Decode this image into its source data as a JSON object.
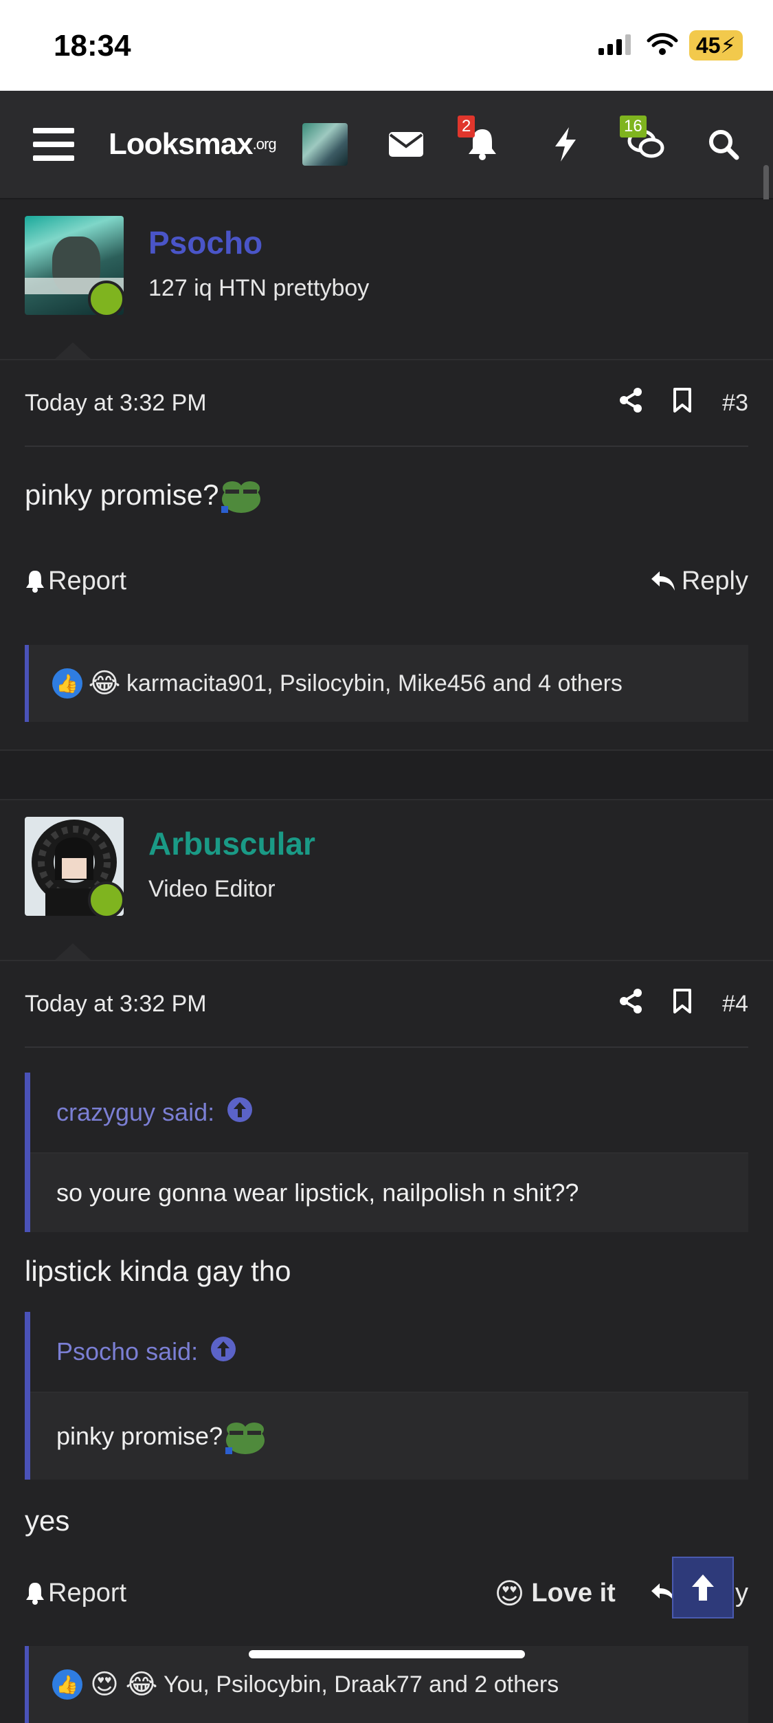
{
  "status": {
    "time": "18:34",
    "battery": "45"
  },
  "navbar": {
    "logo_main": "Looksmax",
    "logo_suffix": ".org",
    "alerts_badge": "2",
    "conversations_badge": "16"
  },
  "posts": [
    {
      "username": "Psocho",
      "username_color": "#4a55c8",
      "user_title": "127 iq HTN prettyboy",
      "date": "Today at 3:32 PM",
      "post_number": "#3",
      "content": "pinky promise?",
      "report_label": "Report",
      "reply_label": "Reply",
      "reactions_text": "karmacita901, Psilocybin, Mike456 and 4 others"
    },
    {
      "username": "Arbuscular",
      "username_color": "#1a9a86",
      "user_title": "Video Editor",
      "date": "Today at 3:32 PM",
      "post_number": "#4",
      "quote1": {
        "author": "crazyguy said:",
        "text": "so youre gonna wear lipstick, nailpolish n shit??"
      },
      "reply1": "lipstick kinda gay tho",
      "quote2": {
        "author": "Psocho said:",
        "text": "pinky promise?"
      },
      "reply2": "yes",
      "report_label": "Report",
      "love_label": "Love it",
      "reply_label": "Reply",
      "reactions_text": "You, Psilocybin, Draak77 and 2 others"
    }
  ]
}
